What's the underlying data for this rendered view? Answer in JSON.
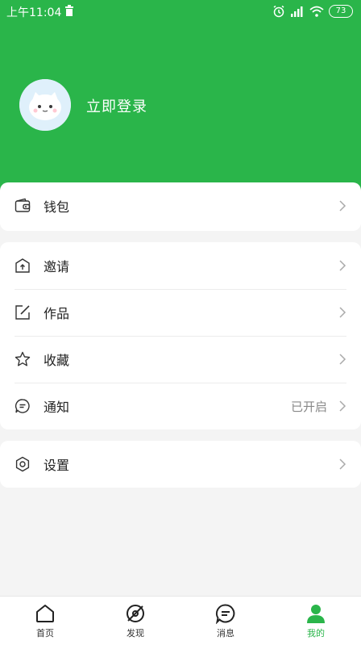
{
  "status_bar": {
    "time": "上午11:04",
    "battery": "73"
  },
  "profile": {
    "login_text": "立即登录"
  },
  "menu": {
    "wallet": {
      "label": "钱包"
    },
    "invite": {
      "label": "邀请"
    },
    "works": {
      "label": "作品"
    },
    "favorites": {
      "label": "收藏"
    },
    "notify": {
      "label": "通知",
      "value": "已开启"
    },
    "settings": {
      "label": "设置"
    }
  },
  "tabs": [
    {
      "label": "首页",
      "icon": "home-icon"
    },
    {
      "label": "发现",
      "icon": "discover-icon"
    },
    {
      "label": "消息",
      "icon": "message-icon"
    },
    {
      "label": "我的",
      "icon": "profile-icon"
    }
  ],
  "colors": {
    "brand": "#2ab54a",
    "background": "#f4f4f4"
  }
}
